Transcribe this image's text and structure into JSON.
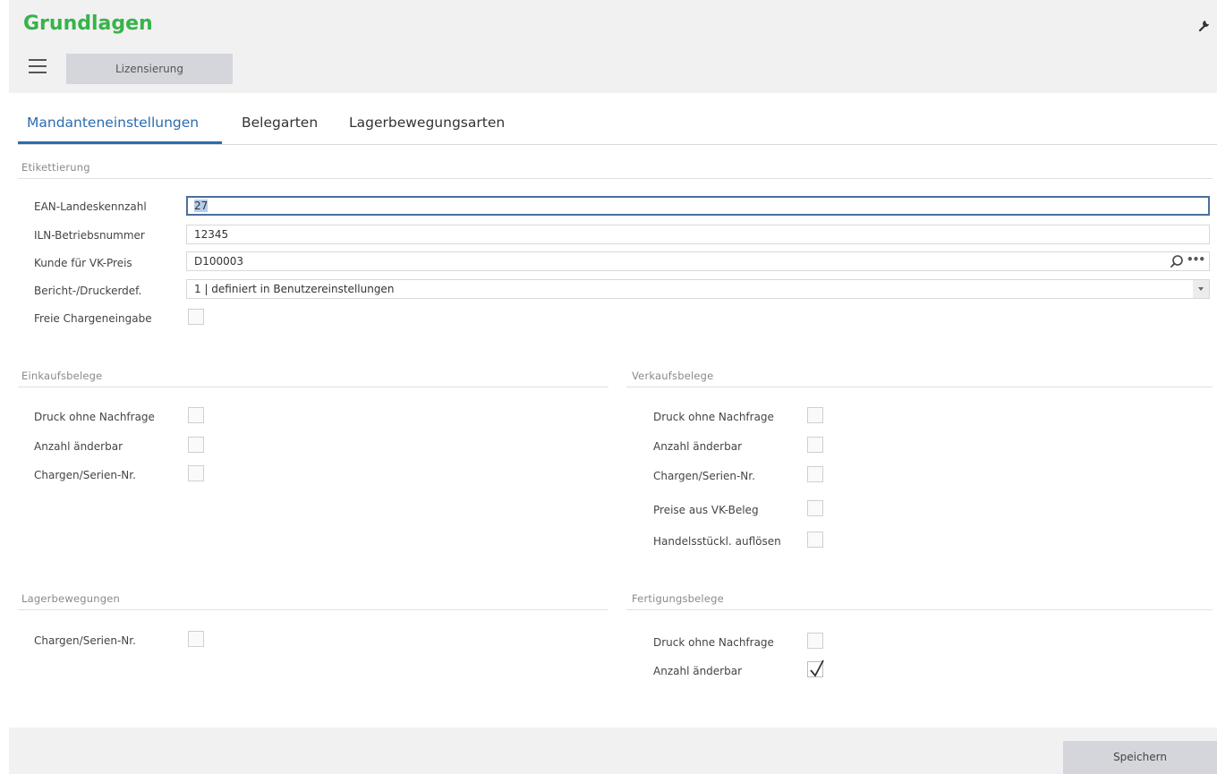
{
  "app": {
    "title": "Grundlagen"
  },
  "toolbar": {
    "lic_label": "Lizensierung",
    "save_label": "Speichern"
  },
  "tabs": [
    {
      "label": "Mandanteneinstellungen",
      "active": true
    },
    {
      "label": "Belegarten",
      "active": false
    },
    {
      "label": "Lagerbewegungsarten",
      "active": false
    }
  ],
  "etikettierung": {
    "title": "Etikettierung",
    "ean": {
      "label": "EAN-Landeskennzahl",
      "value": "27"
    },
    "iln": {
      "label": "ILN-Betriebsnummer",
      "value": "12345"
    },
    "kunde": {
      "label": "Kunde für VK-Preis",
      "value": "D100003"
    },
    "bericht": {
      "label": "Bericht-/Druckerdef.",
      "value": "1  |  definiert in Benutzereinstellungen"
    },
    "freie": {
      "label": "Freie Chargeneingabe",
      "checked": false
    }
  },
  "einkauf": {
    "title": "Einkaufsbelege",
    "items": [
      {
        "label": "Druck ohne Nachfrage",
        "checked": false
      },
      {
        "label": "Anzahl änderbar",
        "checked": false
      },
      {
        "label": "Chargen/Serien-Nr.",
        "checked": false
      }
    ]
  },
  "verkauf": {
    "title": "Verkaufsbelege",
    "items": [
      {
        "label": "Druck ohne Nachfrage",
        "checked": false
      },
      {
        "label": "Anzahl änderbar",
        "checked": false
      },
      {
        "label": "Chargen/Serien-Nr.",
        "checked": false
      },
      {
        "label": "Preise aus VK-Beleg",
        "checked": false
      },
      {
        "label": "Handelsstückl. auflösen",
        "checked": false
      }
    ]
  },
  "lager": {
    "title": "Lagerbewegungen",
    "items": [
      {
        "label": "Chargen/Serien-Nr.",
        "checked": false
      }
    ]
  },
  "fertigung": {
    "title": "Fertigungsbelege",
    "items": [
      {
        "label": "Druck ohne Nachfrage",
        "checked": false
      },
      {
        "label": "Anzahl änderbar",
        "checked": true
      }
    ]
  },
  "colors": {
    "title_green": "#37b34a",
    "tab_blue": "#2b6cb0",
    "focus_border": "#4a6f9e"
  },
  "icons": [
    "menu-icon",
    "wrench-icon",
    "search-icon",
    "more-icon",
    "dropdown-arrow-icon",
    "checkmark-icon"
  ]
}
